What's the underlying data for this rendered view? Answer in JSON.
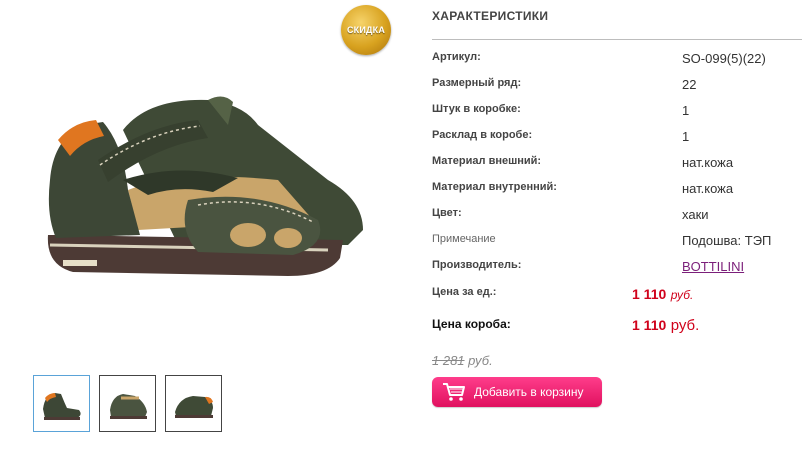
{
  "product": {
    "badge": "СКИДКА",
    "thumb_count": 3
  },
  "specs": {
    "title": "ХАРАКТЕРИСТИКИ",
    "rows": [
      {
        "label": "Артикул:",
        "value": "SO-099(5)(22)"
      },
      {
        "label": "Размерный ряд:",
        "value": "22"
      },
      {
        "label": "Штук в коробке:",
        "value": "1"
      },
      {
        "label": "Расклад в коробе:",
        "value": "1"
      },
      {
        "label": "Материал внешний:",
        "value": "нат.кожа"
      },
      {
        "label": "Материал внутренний:",
        "value": "нат.кожа"
      },
      {
        "label": "Цвет:",
        "value": "хаки"
      },
      {
        "label": "Примечание",
        "value": "Подошва: ТЭП"
      },
      {
        "label": "Производитель:",
        "value": "BOTTILINI"
      }
    ],
    "unit_price": {
      "label": "Цена за ед.:",
      "value": "1 110",
      "currency": "руб."
    },
    "box_price": {
      "label": "Цена короба:",
      "value": "1 110",
      "currency": "руб."
    }
  },
  "old_price": {
    "value": "1 281",
    "currency": "руб."
  },
  "cart_button": {
    "label": "Добавить в корзину"
  },
  "colors": {
    "price": "#d0021b",
    "button": "#e0115f",
    "link": "#7b1f7a"
  }
}
